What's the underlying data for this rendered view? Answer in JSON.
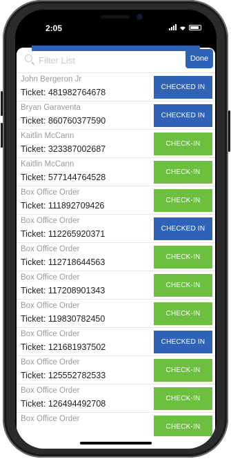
{
  "status_bar": {
    "time": "2:05"
  },
  "search": {
    "placeholder": "Filter List",
    "value": "",
    "done_label": "Done"
  },
  "attendees": [
    {
      "name": "John Bergeron Jr",
      "ticket": "Ticket: 481982764678",
      "button": "CHECKED IN",
      "state": "checked"
    },
    {
      "name": "Bryan Garaventa",
      "ticket": "Ticket: 860760377590",
      "button": "CHECKED IN",
      "state": "checked"
    },
    {
      "name": "Kaitlin McCann",
      "ticket": "Ticket: 323387002687",
      "button": "CHECK-IN",
      "state": "checkin"
    },
    {
      "name": "Kaitlin McCann",
      "ticket": "Ticket: 577144764528",
      "button": "CHECK-IN",
      "state": "checkin"
    },
    {
      "name": "Box Office Order",
      "ticket": "Ticket: 111892709426",
      "button": "CHECK-IN",
      "state": "checkin"
    },
    {
      "name": "Box Office Order",
      "ticket": "Ticket: 112265920371",
      "button": "CHECKED IN",
      "state": "checked"
    },
    {
      "name": "Box Office Order",
      "ticket": "Ticket: 112718644563",
      "button": "CHECK-IN",
      "state": "checkin"
    },
    {
      "name": "Box Office Order",
      "ticket": "Ticket: 117208901343",
      "button": "CHECK-IN",
      "state": "checkin"
    },
    {
      "name": "Box Office Order",
      "ticket": "Ticket: 119830782450",
      "button": "CHECK-IN",
      "state": "checkin"
    },
    {
      "name": "Box Office Order",
      "ticket": "Ticket: 121681937502",
      "button": "CHECKED IN",
      "state": "checked"
    },
    {
      "name": "Box Office Order",
      "ticket": "Ticket: 125552782533",
      "button": "CHECK-IN",
      "state": "checkin"
    },
    {
      "name": "Box Office Order",
      "ticket": "Ticket: 126494492708",
      "button": "CHECK-IN",
      "state": "checkin"
    },
    {
      "name": "Box Office Order",
      "ticket": "",
      "button": "CHECK-IN",
      "state": "checkin"
    }
  ],
  "colors": {
    "checked_in": "#2f63b8",
    "check_in": "#6dbf3f",
    "header_blue": "#2f63b8"
  }
}
